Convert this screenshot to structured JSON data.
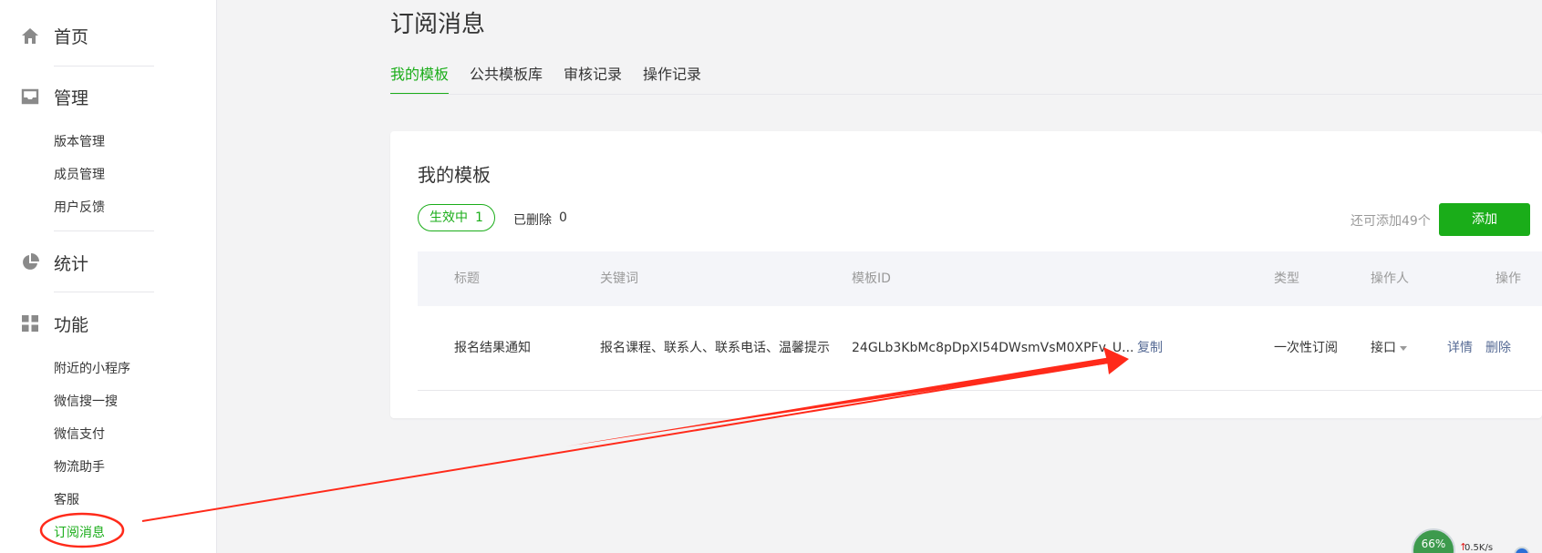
{
  "sidebar": {
    "home": "首页",
    "manage": "管理",
    "manage_items": [
      "版本管理",
      "成员管理",
      "用户反馈"
    ],
    "stats": "统计",
    "features": "功能",
    "feature_items": [
      "附近的小程序",
      "微信搜一搜",
      "微信支付",
      "物流助手",
      "客服",
      "订阅消息"
    ]
  },
  "page_title": "订阅消息",
  "tabs": [
    "我的模板",
    "公共模板库",
    "审核记录",
    "操作记录"
  ],
  "card": {
    "title": "我的模板",
    "active_label": "生效中",
    "active_count": "1",
    "deleted_label": "已删除",
    "deleted_count": "0",
    "remaining": "还可添加49个",
    "add_button": "添加",
    "headers": [
      "标题",
      "关键词",
      "模板ID",
      "类型",
      "操作人",
      "操作"
    ],
    "row": {
      "title": "报名结果通知",
      "keywords": "报名课程、联系人、联系电话、温馨提示",
      "template_id": "24GLb3KbMc8pDpXI54DWsmVsM0XPFv_U...",
      "copy": "复制",
      "type": "一次性订阅",
      "operator": "接口",
      "detail": "详情",
      "delete": "删除"
    }
  },
  "widget": {
    "percent": "66%",
    "speed": "0.5K/s"
  },
  "colors": {
    "accent": "#1aad19",
    "link": "#576b95",
    "annotation": "#ff2a1a"
  }
}
